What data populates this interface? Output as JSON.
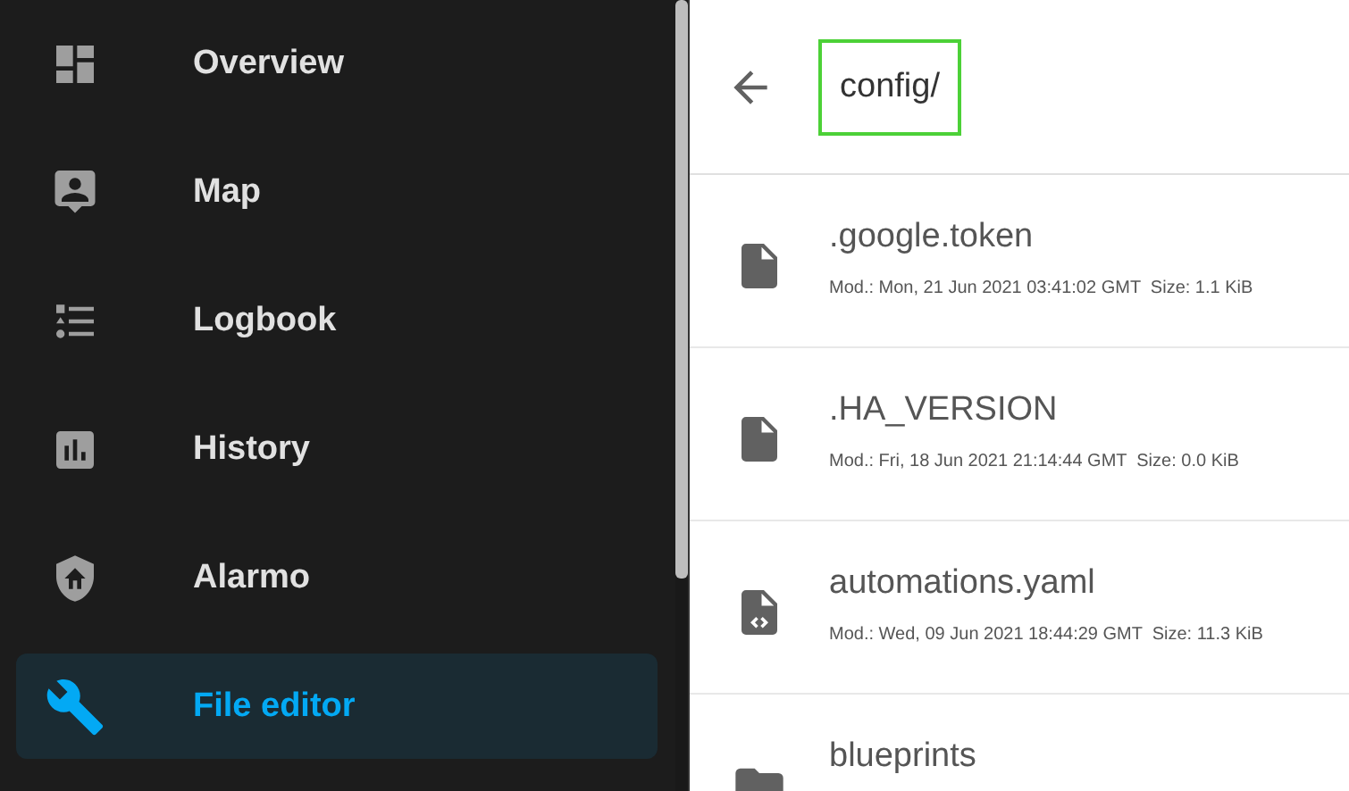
{
  "sidebar": {
    "items": [
      {
        "label": "Overview",
        "selected": false
      },
      {
        "label": "Map",
        "selected": false
      },
      {
        "label": "Logbook",
        "selected": false
      },
      {
        "label": "History",
        "selected": false
      },
      {
        "label": "Alarmo",
        "selected": false
      },
      {
        "label": "File editor",
        "selected": true
      }
    ]
  },
  "browser": {
    "path": "config/",
    "entries": [
      {
        "kind": "file",
        "name": ".google.token",
        "meta": "Mod.: Mon, 21 Jun 2021 03:41:02 GMT  Size: 1.1 KiB"
      },
      {
        "kind": "file",
        "name": ".HA_VERSION",
        "meta": "Mod.: Fri, 18 Jun 2021 21:14:44 GMT  Size: 0.0 KiB"
      },
      {
        "kind": "code",
        "name": "automations.yaml",
        "meta": "Mod.: Wed, 09 Jun 2021 18:44:29 GMT  Size: 11.3 KiB"
      },
      {
        "kind": "folder",
        "name": "blueprints"
      }
    ]
  }
}
